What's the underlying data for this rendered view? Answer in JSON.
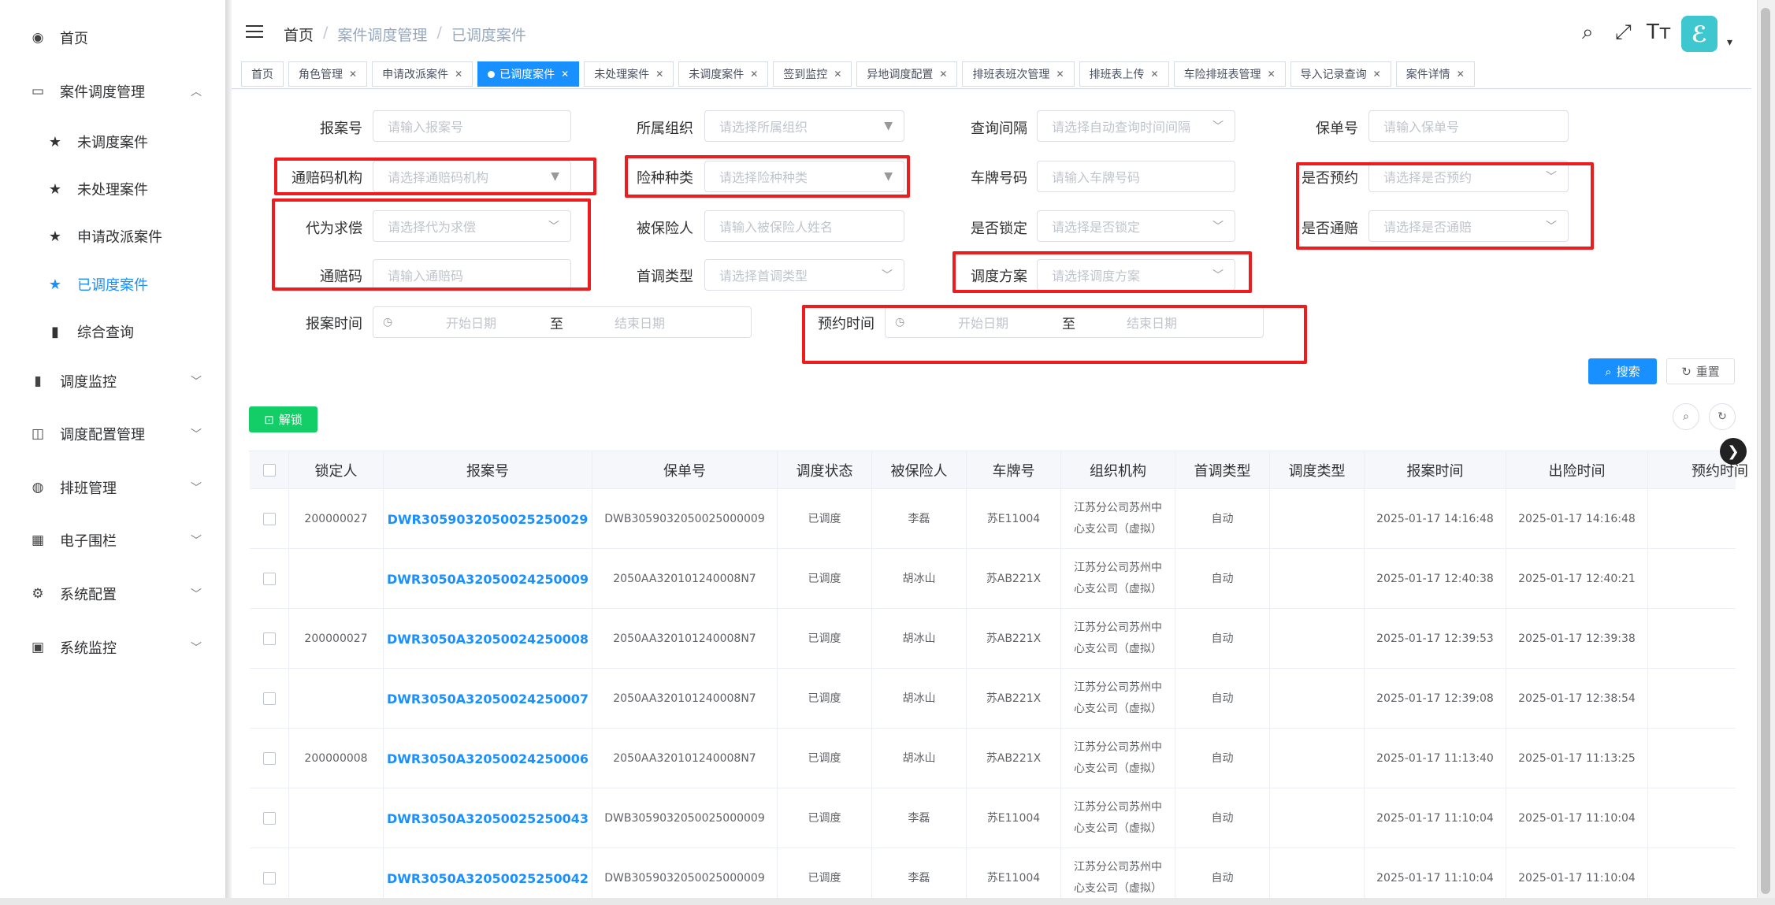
{
  "sidebar": {
    "items": [
      {
        "label": "首页",
        "icon": "dashboard-icon",
        "glyph": "◉"
      },
      {
        "label": "案件调度管理",
        "icon": "briefcase-icon",
        "glyph": "▭",
        "expanded": true
      },
      {
        "label": "调度监控",
        "icon": "bar-chart-icon",
        "glyph": "▮"
      },
      {
        "label": "调度配置管理",
        "icon": "config-icon",
        "glyph": "◫"
      },
      {
        "label": "排班管理",
        "icon": "globe-icon",
        "glyph": "◍"
      },
      {
        "label": "电子围栏",
        "icon": "grid-icon",
        "glyph": "▦"
      },
      {
        "label": "系统配置",
        "icon": "gear-icon",
        "glyph": "⚙"
      },
      {
        "label": "系统监控",
        "icon": "monitor-icon",
        "glyph": "▣"
      }
    ],
    "subitems": [
      {
        "label": "未调度案件",
        "icon": "star-icon"
      },
      {
        "label": "未处理案件",
        "icon": "star-icon"
      },
      {
        "label": "申请改派案件",
        "icon": "star-icon"
      },
      {
        "label": "已调度案件",
        "icon": "star-icon",
        "active": true
      },
      {
        "label": "综合查询",
        "icon": "bar-chart-icon"
      }
    ]
  },
  "header": {
    "breadcrumb": [
      "首页",
      "案件调度管理",
      "已调度案件"
    ]
  },
  "tabs": [
    {
      "label": "首页",
      "closable": false
    },
    {
      "label": "角色管理",
      "closable": true
    },
    {
      "label": "申请改派案件",
      "closable": true
    },
    {
      "label": "已调度案件",
      "closable": true,
      "active": true
    },
    {
      "label": "未处理案件",
      "closable": true
    },
    {
      "label": "未调度案件",
      "closable": true
    },
    {
      "label": "签到监控",
      "closable": true
    },
    {
      "label": "异地调度配置",
      "closable": true
    },
    {
      "label": "排班表班次管理",
      "closable": true
    },
    {
      "label": "排班表上传",
      "closable": true
    },
    {
      "label": "车险排班表管理",
      "closable": true
    },
    {
      "label": "导入记录查询",
      "closable": true
    },
    {
      "label": "案件详情",
      "closable": true
    }
  ],
  "filters": {
    "report_no": {
      "label": "报案号",
      "placeholder": "请输入报案号"
    },
    "org": {
      "label": "所属组织",
      "placeholder": "请选择所属组织"
    },
    "query_interval": {
      "label": "查询间隔",
      "placeholder": "请选择自动查询时间间隔"
    },
    "policy_no": {
      "label": "保单号",
      "placeholder": "请输入保单号"
    },
    "tonpei_org": {
      "label": "通赔码机构",
      "placeholder": "请选择通赔码机构"
    },
    "insurance_type": {
      "label": "险种种类",
      "placeholder": "请选择险种种类"
    },
    "plate": {
      "label": "车牌号码",
      "placeholder": "请输入车牌号码"
    },
    "is_reserved": {
      "label": "是否预约",
      "placeholder": "请选择是否预约"
    },
    "proxy_claim": {
      "label": "代为求偿",
      "placeholder": "请选择代为求偿"
    },
    "insured": {
      "label": "被保险人",
      "placeholder": "请输入被保险人姓名"
    },
    "is_locked": {
      "label": "是否锁定",
      "placeholder": "请选择是否锁定"
    },
    "is_tonpei": {
      "label": "是否通赔",
      "placeholder": "请选择是否通赔"
    },
    "tonpei_code": {
      "label": "通赔码",
      "placeholder": "请输入通赔码"
    },
    "first_dispatch": {
      "label": "首调类型",
      "placeholder": "请选择首调类型"
    },
    "dispatch_plan": {
      "label": "调度方案",
      "placeholder": "请选择调度方案"
    },
    "report_time": {
      "label": "报案时间",
      "start": "开始日期",
      "sep": "至",
      "end": "结束日期"
    },
    "reserve_time": {
      "label": "预约时间",
      "start": "开始日期",
      "sep": "至",
      "end": "结束日期"
    }
  },
  "buttons": {
    "search": "搜索",
    "reset": "重置",
    "unlock": "解锁"
  },
  "table": {
    "columns": [
      "",
      "锁定人",
      "报案号",
      "保单号",
      "调度状态",
      "被保险人",
      "车牌号",
      "组织机构",
      "首调类型",
      "调度类型",
      "报案时间",
      "出险时间",
      "预约时间"
    ],
    "rows": [
      {
        "locker": "200000027",
        "report_no": "DWR3059032050025250029",
        "policy_no": "DWB3059032050025000009",
        "status": "已调度",
        "insured": "李磊",
        "plate": "苏E11004",
        "org": "江苏分公司苏州中心支公司（虚拟）",
        "first_type": "自动",
        "dispatch_type": "",
        "report_time": "2025-01-17 14:16:48",
        "accident_time": "2025-01-17 14:16:48",
        "reserve_time": ""
      },
      {
        "locker": "",
        "report_no": "DWR3050A32050024250009",
        "policy_no": "2050AA320101240008N7",
        "status": "已调度",
        "insured": "胡冰山",
        "plate": "苏AB221X",
        "org": "江苏分公司苏州中心支公司（虚拟）",
        "first_type": "自动",
        "dispatch_type": "",
        "report_time": "2025-01-17 12:40:38",
        "accident_time": "2025-01-17 12:40:21",
        "reserve_time": ""
      },
      {
        "locker": "200000027",
        "report_no": "DWR3050A32050024250008",
        "policy_no": "2050AA320101240008N7",
        "status": "已调度",
        "insured": "胡冰山",
        "plate": "苏AB221X",
        "org": "江苏分公司苏州中心支公司（虚拟）",
        "first_type": "自动",
        "dispatch_type": "",
        "report_time": "2025-01-17 12:39:53",
        "accident_time": "2025-01-17 12:39:38",
        "reserve_time": ""
      },
      {
        "locker": "",
        "report_no": "DWR3050A32050024250007",
        "policy_no": "2050AA320101240008N7",
        "status": "已调度",
        "insured": "胡冰山",
        "plate": "苏AB221X",
        "org": "江苏分公司苏州中心支公司（虚拟）",
        "first_type": "自动",
        "dispatch_type": "",
        "report_time": "2025-01-17 12:39:08",
        "accident_time": "2025-01-17 12:38:54",
        "reserve_time": ""
      },
      {
        "locker": "200000008",
        "report_no": "DWR3050A32050024250006",
        "policy_no": "2050AA320101240008N7",
        "status": "已调度",
        "insured": "胡冰山",
        "plate": "苏AB221X",
        "org": "江苏分公司苏州中心支公司（虚拟）",
        "first_type": "自动",
        "dispatch_type": "",
        "report_time": "2025-01-17 11:13:40",
        "accident_time": "2025-01-17 11:13:25",
        "reserve_time": ""
      },
      {
        "locker": "",
        "report_no": "DWR3050A32050025250043",
        "policy_no": "DWB3059032050025000009",
        "status": "已调度",
        "insured": "李磊",
        "plate": "苏E11004",
        "org": "江苏分公司苏州中心支公司（虚拟）",
        "first_type": "自动",
        "dispatch_type": "",
        "report_time": "2025-01-17 11:10:04",
        "accident_time": "2025-01-17 11:10:04",
        "reserve_time": ""
      },
      {
        "locker": "",
        "report_no": "DWR3050A32050025250042",
        "policy_no": "DWB3059032050025000009",
        "status": "已调度",
        "insured": "李磊",
        "plate": "苏E11004",
        "org": "江苏分公司苏州中心支公司（虚拟）",
        "first_type": "自动",
        "dispatch_type": "",
        "report_time": "2025-01-17 11:10:04",
        "accident_time": "2025-01-17 11:10:04",
        "reserve_time": ""
      }
    ]
  },
  "colors": {
    "accent": "#1890ff",
    "success": "#13ce66",
    "highlight": "#ee1c1c",
    "avatar": "#3ec7cf"
  }
}
